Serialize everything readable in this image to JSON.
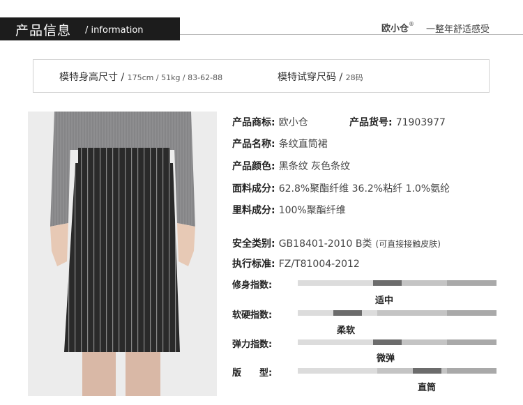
{
  "header": {
    "title": "产品信息",
    "subtitle": "/ information",
    "brand": "欧小仓",
    "brand_mark": "®",
    "slogan": "一整年舒适感受"
  },
  "model": {
    "size_label": "模特身高尺寸 /",
    "size_value": "175cm / 51kg / 83-62-88",
    "try_label": "模特试穿尺码 /",
    "try_value": "28码"
  },
  "product": {
    "brand_label": "产品商标:",
    "brand_value": "欧小仓",
    "sku_label": "产品货号:",
    "sku_value": "71903977",
    "name_label": "产品名称:",
    "name_value": "条纹直筒裙",
    "color_label": "产品颜色:",
    "color_value": "黑条纹 灰色条纹",
    "fabric_label": "面料成分:",
    "fabric_value": "62.8%聚酯纤维  36.2%粘纤  1.0%氨纶",
    "lining_label": "里料成分:",
    "lining_value": "100%聚酯纤维",
    "safety_label": "安全类别:",
    "safety_value": "GB18401-2010 B类",
    "safety_note": "(可直接接触皮肤)",
    "standard_label": "执行标准:",
    "standard_value": "FZ/T81004-2012"
  },
  "scales": [
    {
      "label": "修身指数:",
      "value": "适中",
      "level": 0.45
    },
    {
      "label": "软硬指数:",
      "value": "柔软",
      "level": 0.25
    },
    {
      "label": "弹力指数:",
      "value": "微弹",
      "level": 0.45
    },
    {
      "label": "版　　型:",
      "value": "直筒",
      "level": 0.65
    }
  ]
}
